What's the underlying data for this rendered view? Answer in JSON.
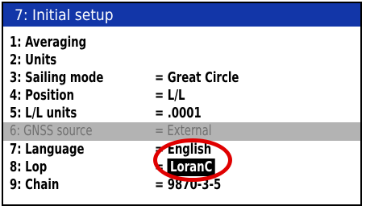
{
  "title": "7: Initial setup",
  "items": [
    {
      "label": "1: Averaging",
      "value": ""
    },
    {
      "label": "2: Units",
      "value": ""
    },
    {
      "label": "3: Sailing mode",
      "value": "= Great Circle"
    },
    {
      "label": "4: Position",
      "value": "= L/L"
    },
    {
      "label": "5: L/L units",
      "value": "= .0001"
    },
    {
      "label": "6: GNSS source",
      "value": "= External"
    },
    {
      "label": "7: Language",
      "value": "= English"
    },
    {
      "label": "8: Lop",
      "value_prefix": "=",
      "value_selected": "LoranC"
    },
    {
      "label": "9: Chain",
      "value": "= 9870-3-5"
    }
  ],
  "highlight_color": "#e00000"
}
